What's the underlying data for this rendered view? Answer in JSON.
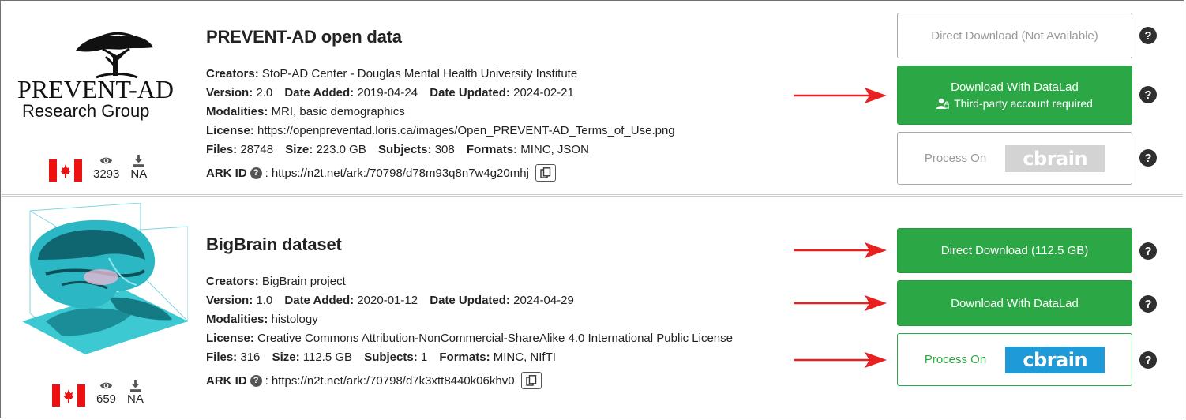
{
  "datasets": [
    {
      "logo_text": {
        "line1": "PREVENT-AD",
        "line2": "Research Group"
      },
      "title": "PREVENT-AD open data",
      "creators_label": "Creators:",
      "creators": "StoP-AD Center - Douglas Mental Health University Institute",
      "version_label": "Version:",
      "version": "2.0",
      "date_added_label": "Date Added:",
      "date_added": "2019-04-24",
      "date_updated_label": "Date Updated:",
      "date_updated": "2024-02-21",
      "modalities_label": "Modalities:",
      "modalities": "MRI, basic demographics",
      "license_label": "License:",
      "license": "https://openpreventad.loris.ca/images/Open_PREVENT-AD_Terms_of_Use.png",
      "files_label": "Files:",
      "files": "28748",
      "size_label": "Size:",
      "size": "223.0 GB",
      "subjects_label": "Subjects:",
      "subjects": "308",
      "formats_label": "Formats:",
      "formats": "MINC, JSON",
      "ark_label": "ARK ID",
      "ark": "https://n2t.net/ark:/70798/d78m93q8n7w4g20mhj",
      "views": "3293",
      "downloads": "NA",
      "buttons": {
        "direct": "Direct Download (Not Available)",
        "datalad": "Download With DataLad",
        "datalad_sub": "Third-party account required",
        "process": "Process On",
        "cbrain": "cbrain"
      }
    },
    {
      "title": "BigBrain dataset",
      "creators_label": "Creators:",
      "creators": "BigBrain project",
      "version_label": "Version:",
      "version": "1.0",
      "date_added_label": "Date Added:",
      "date_added": "2020-01-12",
      "date_updated_label": "Date Updated:",
      "date_updated": "2024-04-29",
      "modalities_label": "Modalities:",
      "modalities": "histology",
      "license_label": "License:",
      "license": "Creative Commons Attribution-NonCommercial-ShareAlike 4.0 International Public License",
      "files_label": "Files:",
      "files": "316",
      "size_label": "Size:",
      "size": "112.5 GB",
      "subjects_label": "Subjects:",
      "subjects": "1",
      "formats_label": "Formats:",
      "formats": "MINC, NIfTI",
      "ark_label": "ARK ID",
      "ark": "https://n2t.net/ark:/70798/d7k3xtt8440k06khv0",
      "views": "659",
      "downloads": "NA",
      "buttons": {
        "direct": "Direct Download (112.5 GB)",
        "datalad": "Download With DataLad",
        "process": "Process On",
        "cbrain": "cbrain"
      }
    }
  ],
  "help_symbol": "?",
  "colors": {
    "green": "#2ca745",
    "arrow": "#e8201f",
    "cbrain_blue": "#1e9ad8",
    "disabled": "#9a9a9a"
  },
  "icons": [
    "canada-flag-icon",
    "eye-icon",
    "download-icon",
    "question-circle-icon",
    "copy-icon",
    "user-lock-icon",
    "red-arrow-icon"
  ]
}
